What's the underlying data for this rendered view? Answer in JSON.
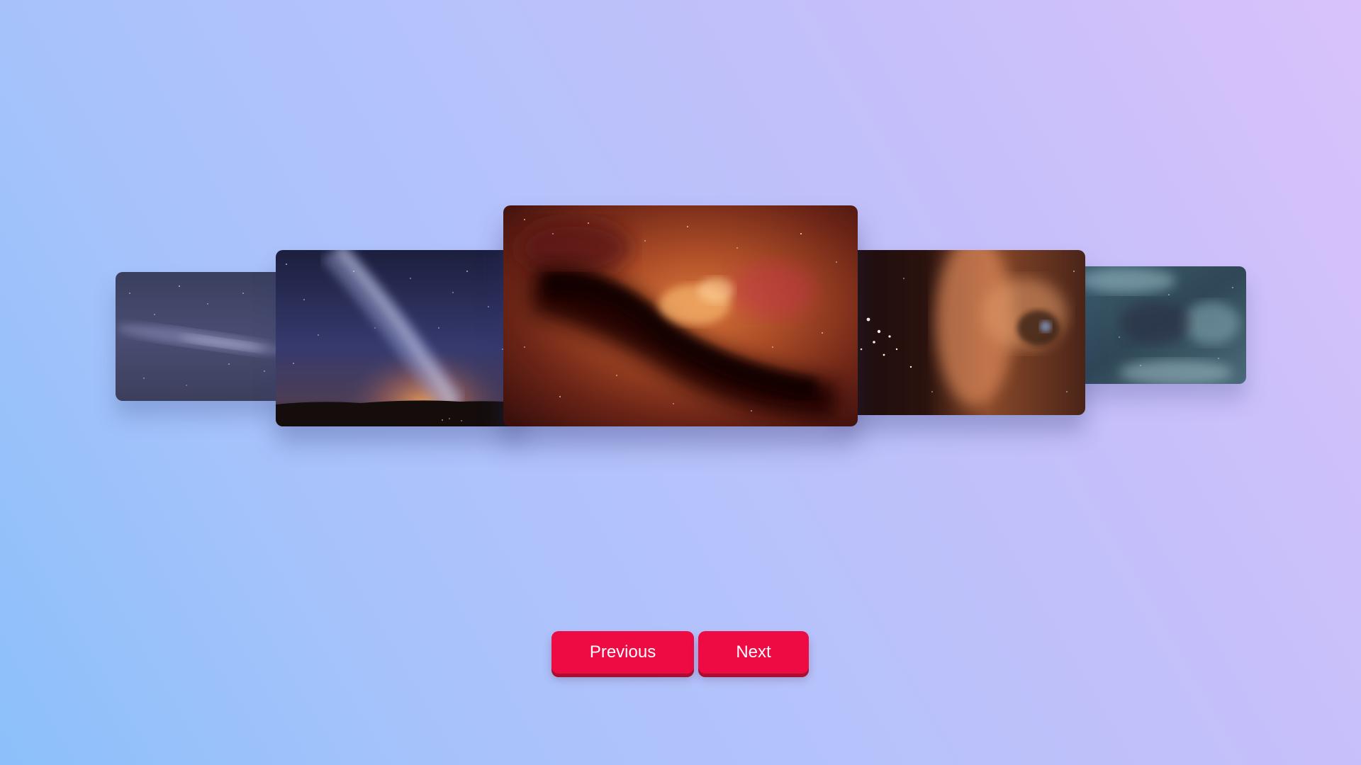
{
  "carousel": {
    "slides": [
      {
        "icon": "milky-way-distant-image",
        "position": "far-left"
      },
      {
        "icon": "milky-way-landscape-image",
        "position": "left"
      },
      {
        "icon": "orange-nebula-image",
        "position": "center-active"
      },
      {
        "icon": "star-cluster-nebula-image",
        "position": "right"
      },
      {
        "icon": "teal-nebula-image",
        "position": "far-right"
      }
    ]
  },
  "controls": {
    "previous_label": "Previous",
    "next_label": "Next"
  },
  "colors": {
    "button": "#ee0a42",
    "background_start": "#8cc0fa",
    "background_end": "#d9c2fb"
  }
}
